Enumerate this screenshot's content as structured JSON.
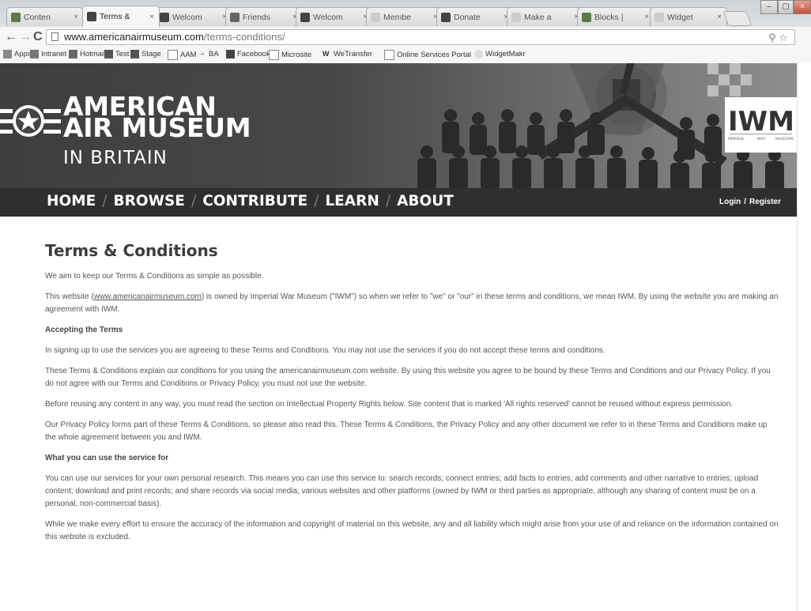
{
  "browser": {
    "tabs": [
      {
        "label": "Conten",
        "active": false
      },
      {
        "label": "Terms &",
        "active": true
      },
      {
        "label": "Welcom",
        "active": false
      },
      {
        "label": "Friends",
        "active": false
      },
      {
        "label": "Welcom",
        "active": false
      },
      {
        "label": "Membe",
        "active": false
      },
      {
        "label": "Donate",
        "active": false
      },
      {
        "label": "Make a",
        "active": false
      },
      {
        "label": "Blocks |",
        "active": false
      },
      {
        "label": "Widget",
        "active": false
      }
    ],
    "tab_close": "×",
    "url_host": "www.americanairmuseum.com",
    "url_path": "/terms-conditions/",
    "bookmarks": [
      {
        "label": "Apps",
        "icon": "apps-icon"
      },
      {
        "label": "Intranet",
        "icon": "intranet-icon"
      },
      {
        "label": "Hotmail",
        "icon": "hotmail-icon"
      },
      {
        "label": "Test",
        "icon": "site-icon"
      },
      {
        "label": "Stage",
        "icon": "site-icon"
      },
      {
        "label": "AAM",
        "icon": "page-icon"
      },
      {
        "label": "BA",
        "icon": "arrow-icon"
      },
      {
        "label": "Facebook",
        "icon": "facebook-icon"
      },
      {
        "label": "Microsite",
        "icon": "page-icon"
      },
      {
        "label": "WeTransfer",
        "icon": "wetransfer-icon"
      },
      {
        "label": "Online Services Portal",
        "icon": "page-icon"
      },
      {
        "label": "WidgetMakr",
        "icon": "widget-icon"
      }
    ]
  },
  "site": {
    "logo_line1": "AMERICAN",
    "logo_line2": "AIR MUSEUM",
    "logo_line3": "IN BRITAIN",
    "iwm": {
      "letters": "IWM",
      "left_text": "IMPERIAL",
      "center_text": "WAR",
      "right_text": "MUSEUMS"
    },
    "nav": [
      {
        "label": "HOME"
      },
      {
        "label": "BROWSE"
      },
      {
        "label": "CONTRIBUTE"
      },
      {
        "label": "LEARN"
      },
      {
        "label": "ABOUT"
      }
    ],
    "nav_separator": "/",
    "login": "Login",
    "auth_separator": "/",
    "register": "Register"
  },
  "page": {
    "title": "Terms & Conditions",
    "intro": "We aim to keep our Terms & Conditions as simple as possible.",
    "p1_before": "This website (",
    "p1_link": "www.americanairmuseum.com",
    "p1_after": ") is owned by Imperial War Museum (\"IWM\") so when we refer to \"we\" or \"our\" in these terms and conditions, we mean IWM. By using the website you are making an agreement with IWM.",
    "h_accepting": "Accepting the Terms",
    "p2": "In signing up to use the services you are agreeing to these Terms and Conditions. You may not use the services if you do not accept these terms and conditions.",
    "p3": "These Terms & Conditions explain our conditions for you using the americanairmuseum.com website. By using this website you agree to be bound by these Terms and Conditions and our Privacy Policy. If you do not agree with our Terms and Conditions or Privacy Policy, you must not use the website.",
    "p4": "Before reusing any content in any way, you must read the section on Intellectual Property Rights below. Site content that is marked 'All rights reserved' cannot be reused without express permission.",
    "p5": "Our Privacy Policy forms part of these Terms & Conditions, so please also read this. These Terms & Conditions, the Privacy Policy and any other document we refer to in these Terms and Conditions make up the whole agreement between you and IWM.",
    "h_use": "What you can use the service for",
    "p6": "You can use our services for your own personal research. This means you can use this service to: search records; connect entries; add facts to entries; add comments and other narrative to entries; upload content; download and print records; and share records via social media, various websites and other platforms (owned by IWM or third parties as appropriate, although any sharing of content must be on a personal, non-commercial basis).",
    "p7": "While we make every effort to ensure the accuracy of the information and copyright of material on this website, any and all liability which might arise from your use of and reliance on the information contained on this website is excluded."
  },
  "colors": {
    "header_dark": "#3e3e3e",
    "nav_bar": "#2f2f2f",
    "title_text": "#3c3c3c",
    "body_text": "#555555"
  }
}
